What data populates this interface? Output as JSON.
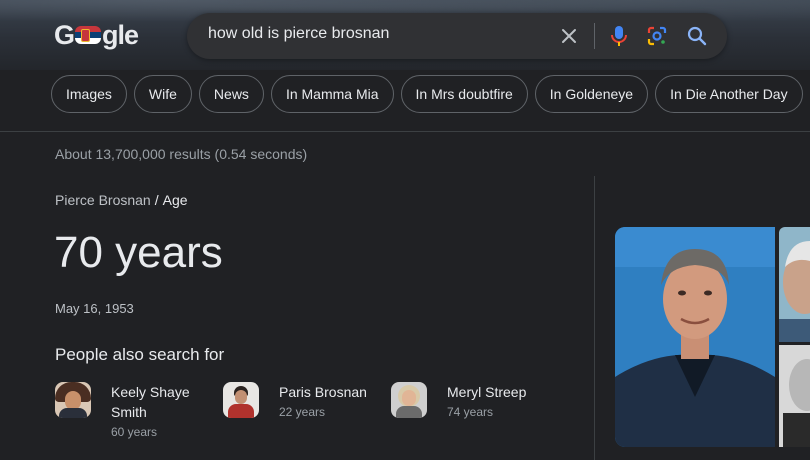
{
  "logo": {
    "g": "G",
    "rest": "gle"
  },
  "search": {
    "query": "how old is pierce brosnan"
  },
  "chips": [
    "Images",
    "Wife",
    "News",
    "In Mamma Mia",
    "In Mrs doubtfire",
    "In Goldeneye",
    "In Die Another Day"
  ],
  "stats": "About 13,700,000 results (0.54 seconds)",
  "breadcrumb": {
    "parent": "Pierce Brosnan",
    "separator": "/",
    "current": "Age"
  },
  "answer": {
    "age": "70 years",
    "birth_date": "May 16, 1953"
  },
  "people_also_search": {
    "title": "People also search for",
    "people": [
      {
        "name_line1": "Keely Shaye",
        "name_line2": "Smith",
        "years": "60 years"
      },
      {
        "name_line1": "Paris Brosnan",
        "name_line2": "",
        "years": "22 years"
      },
      {
        "name_line1": "Meryl Streep",
        "name_line2": "",
        "years": "74 years"
      }
    ]
  },
  "colors": {
    "background": "#202124",
    "search_box": "#303134",
    "text": "#e8eaed",
    "muted": "#9aa0a6"
  }
}
